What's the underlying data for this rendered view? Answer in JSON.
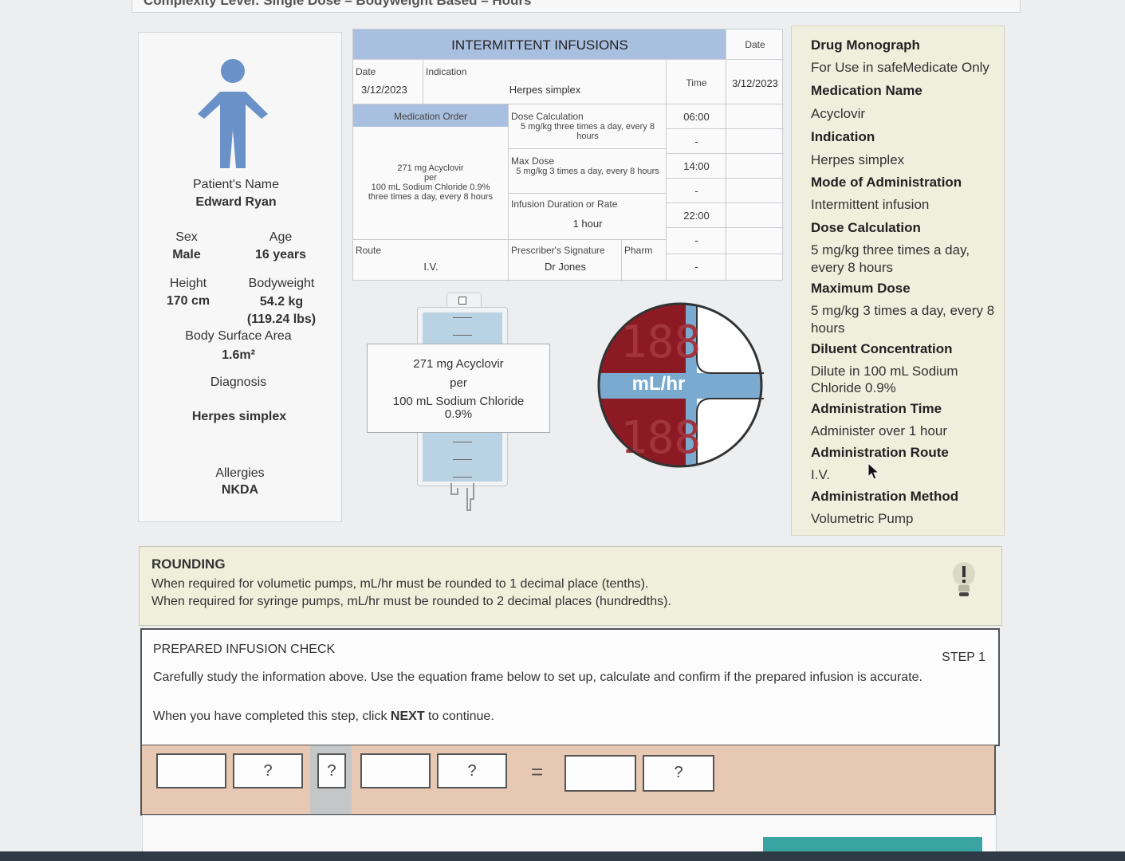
{
  "header": {
    "title": "Complexity Level: Single Dose – Bodyweight Based – Hours"
  },
  "patient": {
    "name_label": "Patient's Name",
    "name": "Edward Ryan",
    "sex_label": "Sex",
    "sex": "Male",
    "age_label": "Age",
    "age": "16 years",
    "height_label": "Height",
    "height": "170 cm",
    "bodyweight_label": "Bodyweight",
    "bodyweight": "54.2 kg",
    "bodyweight_lbs": "(119.24 lbs)",
    "bsa_label": "Body Surface Area",
    "bsa": "1.6m²",
    "diagnosis_label": "Diagnosis",
    "diagnosis": "Herpes simplex",
    "allergies_label": "Allergies",
    "allergies": "NKDA"
  },
  "chart": {
    "title": "INTERMITTENT INFUSIONS",
    "date_col_label": "Date",
    "date_col_value": "3/12/2023",
    "time_label": "Time",
    "times": [
      "06:00",
      "-",
      "14:00",
      "-",
      "22:00",
      "-",
      "-"
    ],
    "date_label": "Date",
    "date": "3/12/2023",
    "indication_label": "Indication",
    "indication": "Herpes simplex",
    "order_label": "Medication Order",
    "order_line1": "271 mg Acyclovir",
    "order_line2": "per",
    "order_line3": "100 mL Sodium Chloride 0.9%",
    "order_line4": "three times a day, every 8 hours",
    "dose_calc_label": "Dose Calculation",
    "dose_calc": "5 mg/kg three times a day, every 8 hours",
    "max_dose_label": "Max Dose",
    "max_dose": "5 mg/kg 3 times a day, every 8 hours",
    "duration_label": "Infusion Duration or Rate",
    "duration": "1 hour",
    "route_label": "Route",
    "route": "I.V.",
    "prescriber_label": "Prescriber's Signature",
    "prescriber": "Dr Jones",
    "pharm_label": "Pharm"
  },
  "bag": {
    "line1": "271 mg Acyclovir",
    "line2": "per",
    "line3": "100 mL Sodium Chloride 0.9%"
  },
  "pump": {
    "unit": "mL/hr",
    "display_top": "188",
    "display_bottom": "188"
  },
  "monograph": {
    "title": "Drug Monograph",
    "subtitle": "For Use in safeMedicate Only",
    "name_h": "Medication Name",
    "name": "Acyclovir",
    "indication_h": "Indication",
    "indication": "Herpes simplex",
    "mode_h": "Mode of Administration",
    "mode": "Intermittent infusion",
    "dose_h": "Dose Calculation",
    "dose_1": "5 mg/kg three times a day,",
    "dose_2": "every 8 hours",
    "max_h": "Maximum Dose",
    "max_1": "5 mg/kg 3 times a day, every 8",
    "max_2": "hours",
    "diluent_h": "Diluent Concentration",
    "diluent_1": "Dilute in 100 mL Sodium",
    "diluent_2": "Chloride 0.9%",
    "time_h": "Administration Time",
    "time": "Administer over 1 hour",
    "route_h": "Administration Route",
    "route": "I.V.",
    "method_h": "Administration Method",
    "method": "Volumetric Pump"
  },
  "rounding": {
    "title": "ROUNDING",
    "line1": "When required for volumetic pumps, mL/hr must be rounded to 1 decimal place (tenths).",
    "line2": "When required for syringe pumps, mL/hr must be rounded to 2 decimal places (hundredths)."
  },
  "check": {
    "title": "PREPARED INFUSION CHECK",
    "step": "STEP 1",
    "instructions": "Carefully study the information above. Use the equation frame below to set up, calculate and confirm if the prepared infusion is accurate.",
    "next_pre": "When you have completed this step, click ",
    "next_word": "NEXT",
    "next_post": " to continue."
  },
  "equation": {
    "q1": "?",
    "q2": "?",
    "q3": "?",
    "q4": "?",
    "equals": "="
  },
  "colors": {
    "pump_red": "#8b1a24",
    "pump_blue": "#7aaad0",
    "chart_header": "#a9bfdf",
    "monograph_bg": "#efefdd",
    "equation_bg": "#e7c8b2"
  }
}
